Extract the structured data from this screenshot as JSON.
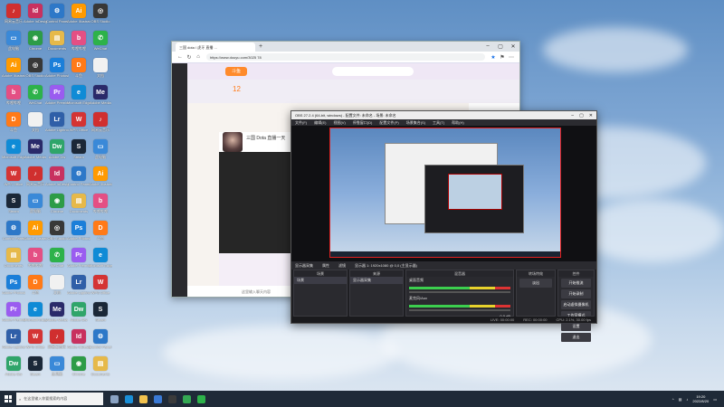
{
  "desktop": {
    "icons": [
      {
        "label": "网易云音乐",
        "color": "#d02f2f",
        "glyph": "♪"
      },
      {
        "label": "此电脑",
        "color": "#3a89d8",
        "glyph": "▭"
      },
      {
        "label": "Adobe Illustrator",
        "color": "#ff9a00",
        "glyph": "Ai"
      },
      {
        "label": "哔哩哔哩",
        "color": "#e44f84",
        "glyph": "b"
      },
      {
        "label": "斗鱼",
        "color": "#ff7a18",
        "glyph": "D"
      },
      {
        "label": "Microsoft Edge",
        "color": "#0f8bd6",
        "glyph": "e"
      },
      {
        "label": "WPS Office",
        "color": "#d43434",
        "glyph": "W"
      },
      {
        "label": "Steam",
        "color": "#1b2838",
        "glyph": "S"
      },
      {
        "label": "Control Panel",
        "color": "#2d78c8",
        "glyph": "⚙"
      },
      {
        "label": "Documents",
        "color": "#e6b94a",
        "glyph": "▤"
      },
      {
        "label": "Adobe Photoshop",
        "color": "#1b7fd9",
        "glyph": "Ps"
      },
      {
        "label": "Adobe Premiere",
        "color": "#9a5cf0",
        "glyph": "Pr"
      },
      {
        "label": "Adobe Lightroom",
        "color": "#2f5fa8",
        "glyph": "Lr"
      },
      {
        "label": "Adobe Dw",
        "color": "#2fa56a",
        "glyph": "Dw"
      },
      {
        "label": "Adobe InDesign",
        "color": "#c8315f",
        "glyph": "Id"
      },
      {
        "label": "Chrome",
        "color": "#2d9c47",
        "glyph": "◉"
      },
      {
        "label": "OBS Studio",
        "color": "#383838",
        "glyph": "◎"
      },
      {
        "label": "WeChat",
        "color": "#2db24a",
        "glyph": "✆"
      },
      {
        "label": "文档",
        "color": "#f1f1f1",
        "glyph": ""
      },
      {
        "label": "Adobe Media",
        "color": "#2a2a6a",
        "glyph": "Me"
      }
    ]
  },
  "browser": {
    "tab_title": "三国 dota / 虎牙 直播 ...",
    "url": "https://www.douyu.com/3025 78",
    "logo": "斗鱼",
    "room_number": "12",
    "stream_title": "三国 Dota 直播一天",
    "comment_placeholder": "这里输入聊天内容"
  },
  "obs": {
    "title": "OBS 27.2.4 (64-bit, windows) - 配置文件: 未命名 - 场景: 未命名",
    "menu": [
      "文件(F)",
      "编辑(E)",
      "视图(V)",
      "停靠窗口(D)",
      "配置文件(P)",
      "场景集合(S)",
      "工具(T)",
      "帮助(H)"
    ],
    "toolbar": [
      "显示器采集",
      "属性",
      "滤镜",
      "显示器  1: 1920x1080 @ 0,0 (主显示器)"
    ],
    "docks": {
      "scenes": {
        "title": "场景",
        "items": [
          "场景"
        ]
      },
      "sources": {
        "title": "来源",
        "items": [
          "显示器采集"
        ]
      },
      "mixer": {
        "title": "混音器",
        "channels": [
          "桌面音频",
          "麦克风/Aux"
        ],
        "level": "0.0 dB"
      },
      "transitions": {
        "title": "转场特效",
        "value": "淡出"
      },
      "controls": {
        "title": "控件",
        "buttons": [
          "开始推流",
          "开始录制",
          "启动虚拟摄像机",
          "工作室模式",
          "设置",
          "退出"
        ]
      }
    },
    "status": [
      "LIVE: 00:00:00",
      "REC: 00:00:00",
      "CPU: 2.1%, 30.00 fps"
    ]
  },
  "taskbar": {
    "search_placeholder": "在这里输入你要搜索的内容",
    "time": "19:20",
    "date": "2022/8/20",
    "apps": [
      {
        "name": "task-view",
        "color": "#8aa2c2"
      },
      {
        "name": "edge",
        "color": "#1a8fd8"
      },
      {
        "name": "file-explorer",
        "color": "#f2c24e"
      },
      {
        "name": "store",
        "color": "#3a7ad6"
      },
      {
        "name": "obs",
        "color": "#3b3b3b"
      },
      {
        "name": "chrome",
        "color": "#34a853"
      },
      {
        "name": "wechat",
        "color": "#2db24a"
      }
    ]
  }
}
